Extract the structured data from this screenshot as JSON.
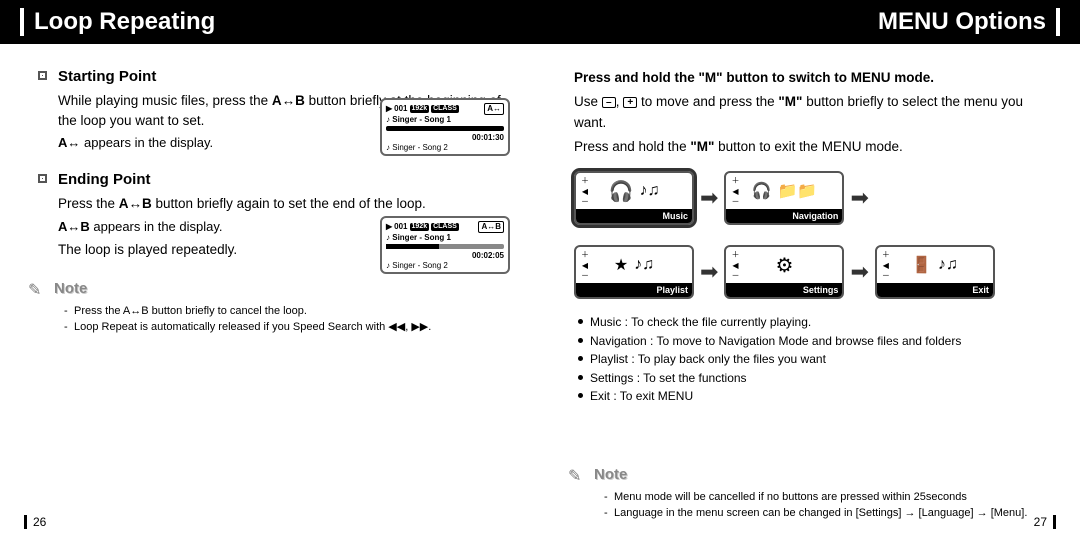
{
  "left": {
    "title": "Loop Repeating",
    "start": {
      "heading": "Starting Point",
      "p1a": "While playing music files, press the ",
      "p1b_key": "A↔B",
      "p1c": " button briefly at the beginning of the loop you want to set.",
      "p2a": "A↔",
      "p2b": " appears in the display."
    },
    "end": {
      "heading": "Ending Point",
      "p1a": "Press the ",
      "p1b_key": "A↔B",
      "p1c": " button briefly again to set the end of the loop.",
      "p2a": "A↔B",
      "p2b": " appears in the display.",
      "p3": "The loop is played repeatedly."
    },
    "note": {
      "title": "Note",
      "items": [
        "Press the A↔B button briefly to cancel the loop.",
        "Loop Repeat is automatically released if you Speed Search with ◀◀, ▶▶."
      ]
    },
    "lcd1": {
      "track": "001",
      "bitrate": "192k",
      "badge": "CLASS",
      "ab": "A↔",
      "line1": "Singer - Song 1",
      "time": "00:01:30",
      "line2": "Singer - Song 2"
    },
    "lcd2": {
      "track": "001",
      "bitrate": "192k",
      "badge": "CLASS",
      "ab": "A↔B",
      "line1": "Singer - Song 1",
      "time": "00:02:05",
      "line2": "Singer - Song 2"
    },
    "pagenum": "26"
  },
  "right": {
    "title": "MENU Options",
    "intro1": "Press and hold the \"M\" button to switch to MENU mode.",
    "intro2a": "Use ",
    "intro2b": " to move and press the ",
    "intro2c_key": "\"M\"",
    "intro2d": " button briefly to select the menu you want.",
    "intro3a": "Press and hold the ",
    "intro3b_key": "\"M\"",
    "intro3c": " button to exit the MENU mode.",
    "menus": {
      "music": "Music",
      "navigation": "Navigation",
      "playlist": "Playlist",
      "settings": "Settings",
      "exit": "Exit"
    },
    "descs": [
      "Music : To check the file currently playing.",
      "Navigation : To move to Navigation Mode and browse files and folders",
      "Playlist : To play back only the files you want",
      "Settings : To set the functions",
      "Exit : To exit MENU"
    ],
    "note": {
      "title": "Note",
      "items": [
        "Menu mode will be cancelled if no buttons are pressed within 25seconds",
        "Language in the menu screen can be changed in [Settings] → [Language] → [Menu]."
      ]
    },
    "pagenum": "27"
  }
}
